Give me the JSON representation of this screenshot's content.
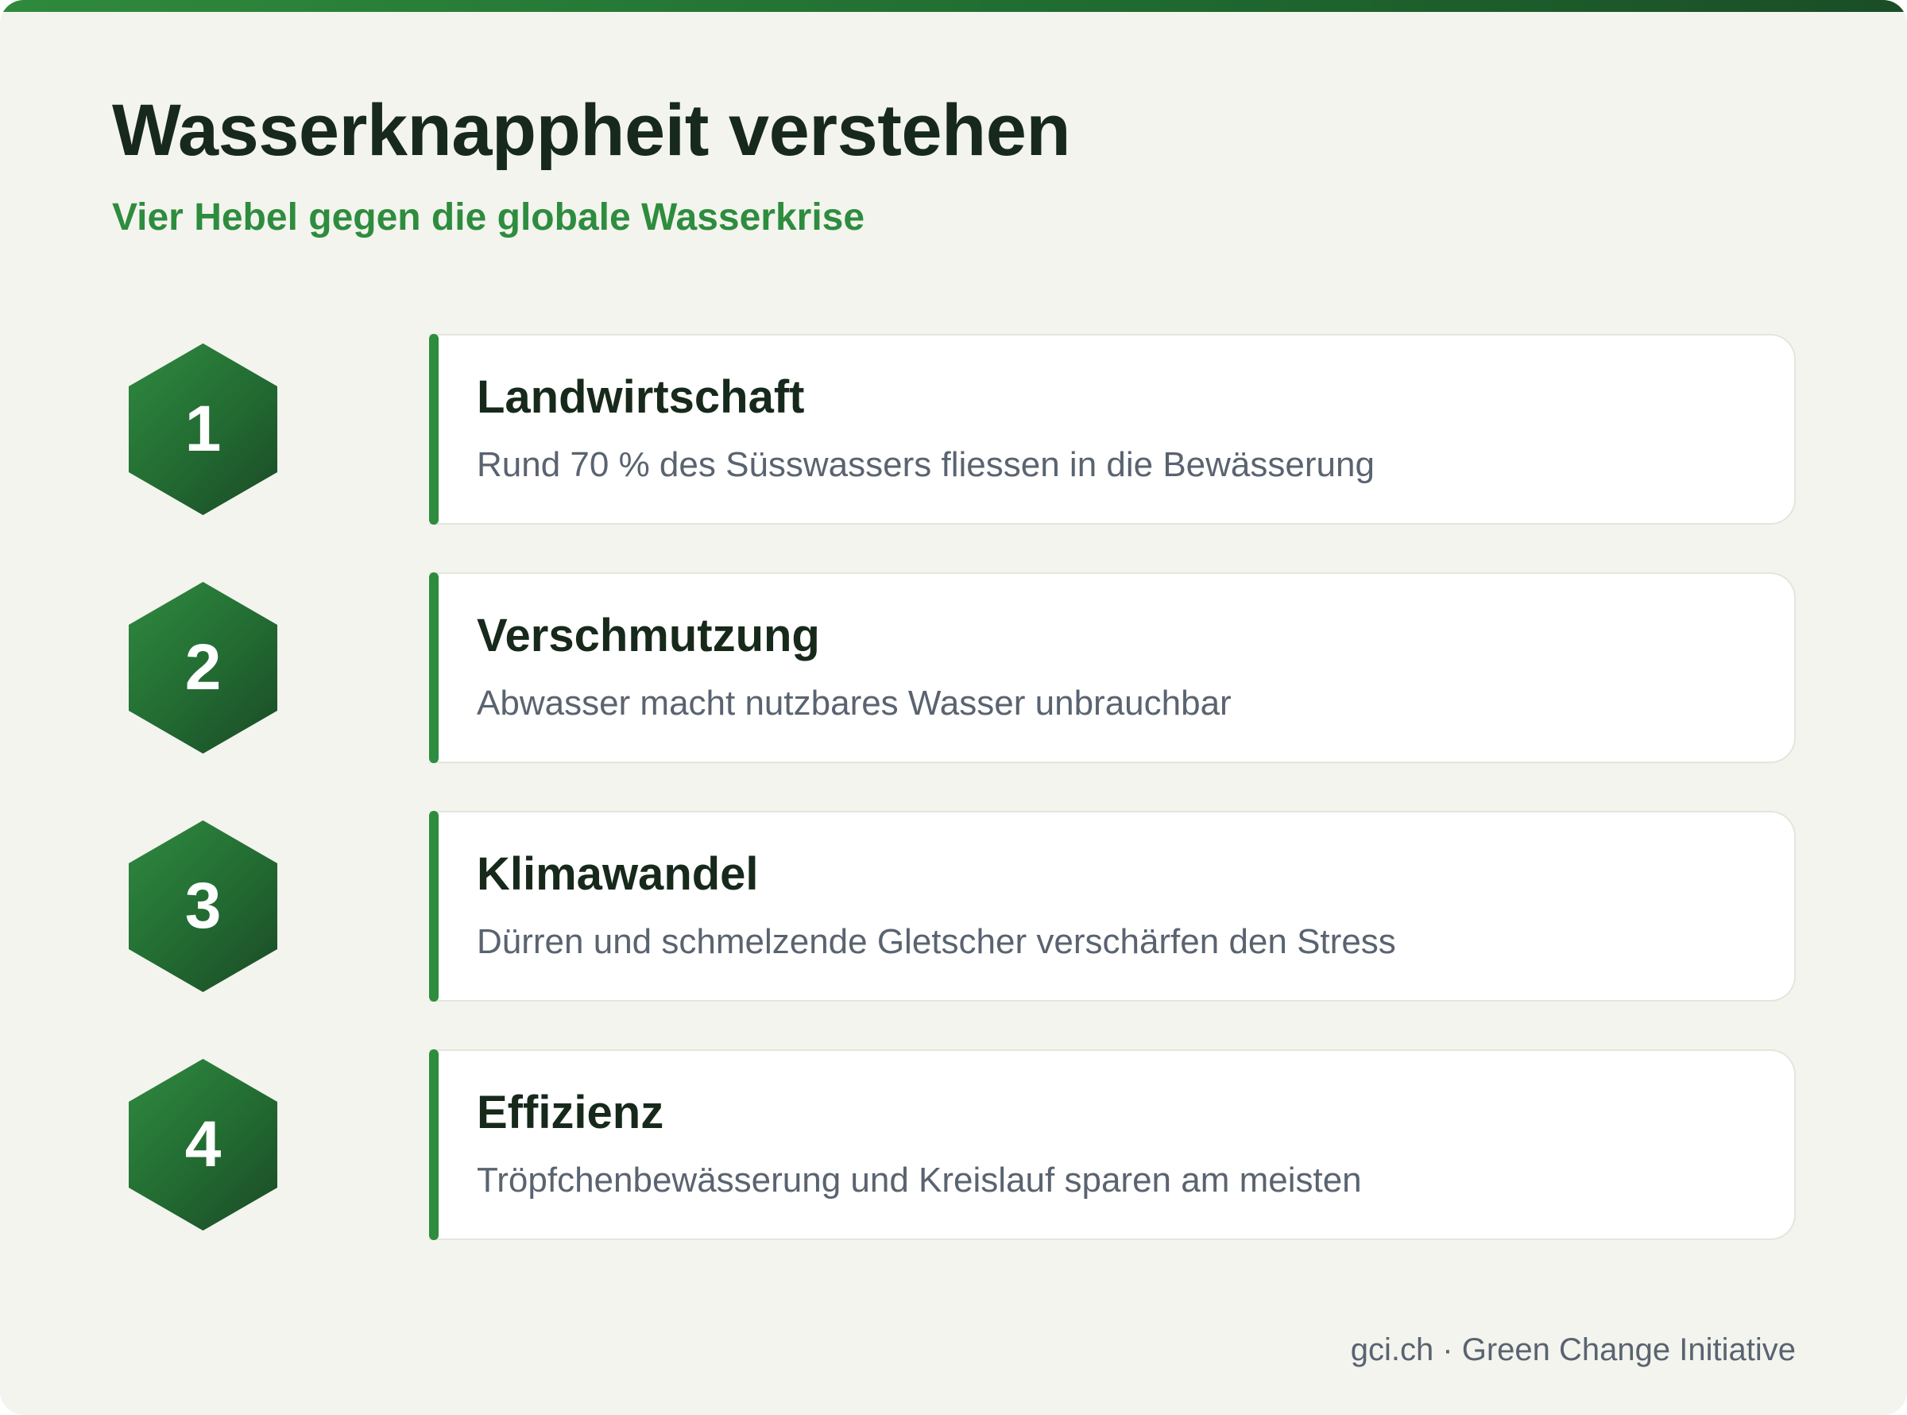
{
  "header": {
    "title": "Wasserknappheit verstehen",
    "subtitle": "Vier Hebel gegen die globale Wasserkrise"
  },
  "items": [
    {
      "number": "1",
      "title": "Landwirtschaft",
      "description": "Rund 70 % des Süsswassers fliessen in die Bewässerung"
    },
    {
      "number": "2",
      "title": "Verschmutzung",
      "description": "Abwasser macht nutzbares Wasser unbrauchbar"
    },
    {
      "number": "3",
      "title": "Klimawandel",
      "description": "Dürren und schmelzende Gletscher verschärfen den Stress"
    },
    {
      "number": "4",
      "title": "Effizienz",
      "description": "Tröpfchenbewässerung und Kreislauf sparen am meisten"
    }
  ],
  "footer": {
    "credit": "gci.ch · Green Change Initiative"
  },
  "colors": {
    "background": "#f3f4ee",
    "accent": "#2e8c3e",
    "title": "#17291b",
    "muted": "#5a6370"
  }
}
